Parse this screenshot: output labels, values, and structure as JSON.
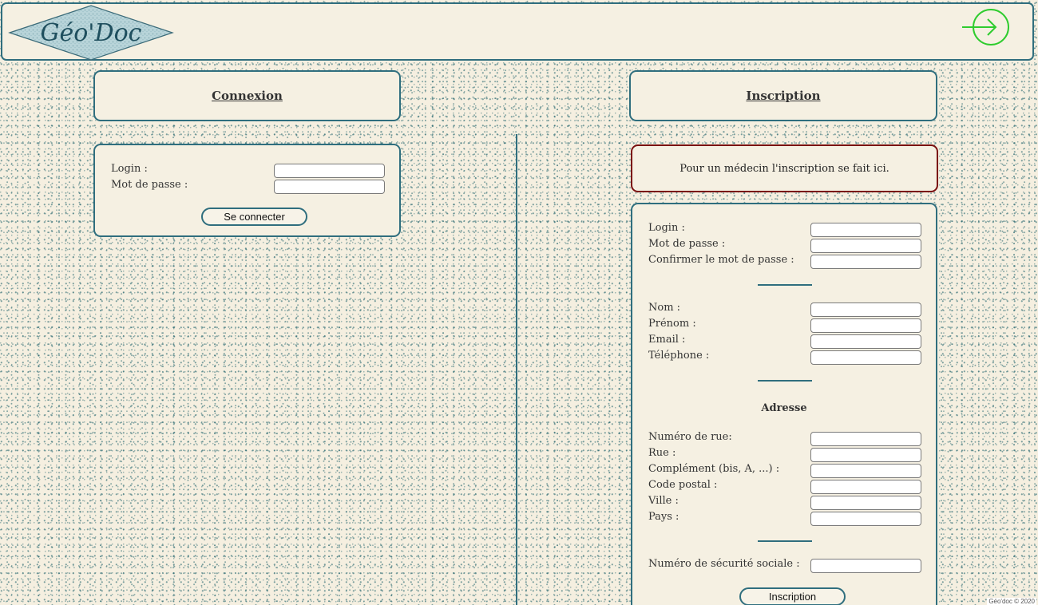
{
  "header": {
    "logo_text": "Géo'Doc",
    "login_icon": "login-arrow-icon"
  },
  "connexion": {
    "title": "Connexion",
    "login_label": "Login :",
    "password_label": "Mot de passe :",
    "login_value": "",
    "password_value": "",
    "submit_label": "Se connecter"
  },
  "inscription": {
    "title": "Inscription",
    "doctor_notice": "Pour un médecin l'inscription se fait ici.",
    "login_label": "Login :",
    "password_label": "Mot de passe :",
    "confirm_password_label": "Confirmer le mot de passe :",
    "nom_label": "Nom :",
    "prenom_label": "Prénom :",
    "email_label": "Email :",
    "telephone_label": "Téléphone :",
    "adresse_title": "Adresse",
    "numero_rue_label": "Numéro de rue:",
    "rue_label": "Rue :",
    "complement_label": "Complément (bis, A, ...) :",
    "code_postal_label": "Code postal :",
    "ville_label": "Ville :",
    "pays_label": "Pays :",
    "secu_label": "Numéro de sécurité sociale :",
    "submit_label": "Inscription"
  },
  "footer": {
    "text": "Géo'doc © 2020"
  },
  "colors": {
    "border": "#2f6e7e",
    "alert_border": "#7a1010",
    "panel_bg": "#f5f0e2",
    "icon_green": "#2ecc2e"
  }
}
